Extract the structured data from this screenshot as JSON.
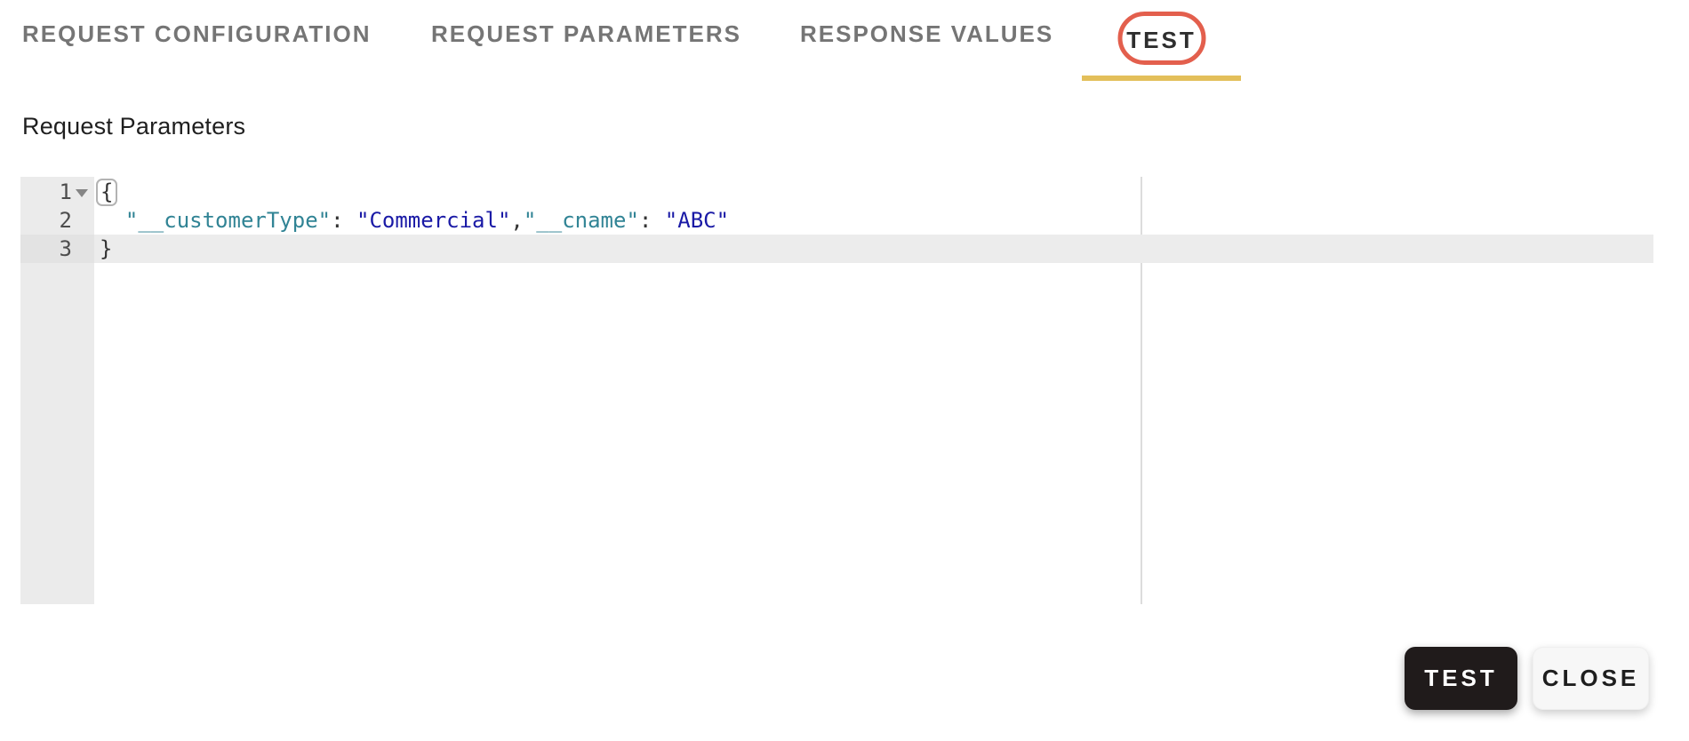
{
  "tabs": {
    "items": [
      {
        "label": "REQUEST CONFIGURATION",
        "active": false
      },
      {
        "label": "REQUEST PARAMETERS",
        "active": false
      },
      {
        "label": "RESPONSE VALUES",
        "active": false
      },
      {
        "label": "TEST",
        "active": true
      }
    ],
    "active_tab": "TEST"
  },
  "section": {
    "title": "Request Parameters"
  },
  "editor": {
    "language": "json",
    "lines": [
      {
        "number": "1",
        "text": "{",
        "foldable": true
      },
      {
        "number": "2",
        "tokens": [
          {
            "type": "whitespace",
            "v": "  "
          },
          {
            "type": "key",
            "v": "\"__customerType\""
          },
          {
            "type": "punct",
            "v": ": "
          },
          {
            "type": "string",
            "v": "\"Commercial\""
          },
          {
            "type": "punct",
            "v": ","
          },
          {
            "type": "key",
            "v": "\"__cname\""
          },
          {
            "type": "punct",
            "v": ": "
          },
          {
            "type": "string",
            "v": "\"ABC\""
          }
        ]
      },
      {
        "number": "3",
        "text": "}",
        "active_line": true
      }
    ]
  },
  "actions": {
    "test_label": "TEST",
    "close_label": "CLOSE"
  },
  "colors": {
    "accent_gold_underline": "#e3bf5a",
    "highlight_ring_red": "#e35f4d",
    "token_key": "#318495",
    "token_string": "#1a1aa6",
    "token_punct": "#333333",
    "gutter_bg": "#ebebeb",
    "active_line_bg": "#ececec",
    "print_margin": "#dcdcdc",
    "button_dark_bg": "#201b1b",
    "button_light_bg": "#f7f7f7",
    "inactive_tab_text": "#757575"
  }
}
